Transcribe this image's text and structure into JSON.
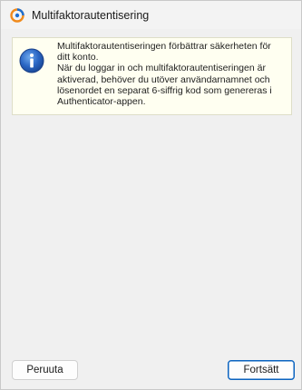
{
  "window": {
    "title": "Multifaktorautentisering"
  },
  "info": {
    "line1": "Multifaktorautentiseringen förbättrar säkerheten för ditt konto.",
    "line2": "När du loggar in och multifaktorautentiseringen är aktiverad, behöver du utöver användarnamnet och lösenordet en separat 6-siffrig kod som genereras i Authenticator-appen.",
    "icon": "info-icon"
  },
  "buttons": {
    "cancel_label": "Peruuta",
    "continue_label": "Fortsätt"
  },
  "colors": {
    "info_background": "#fffff1",
    "accent": "#0a63c0"
  }
}
